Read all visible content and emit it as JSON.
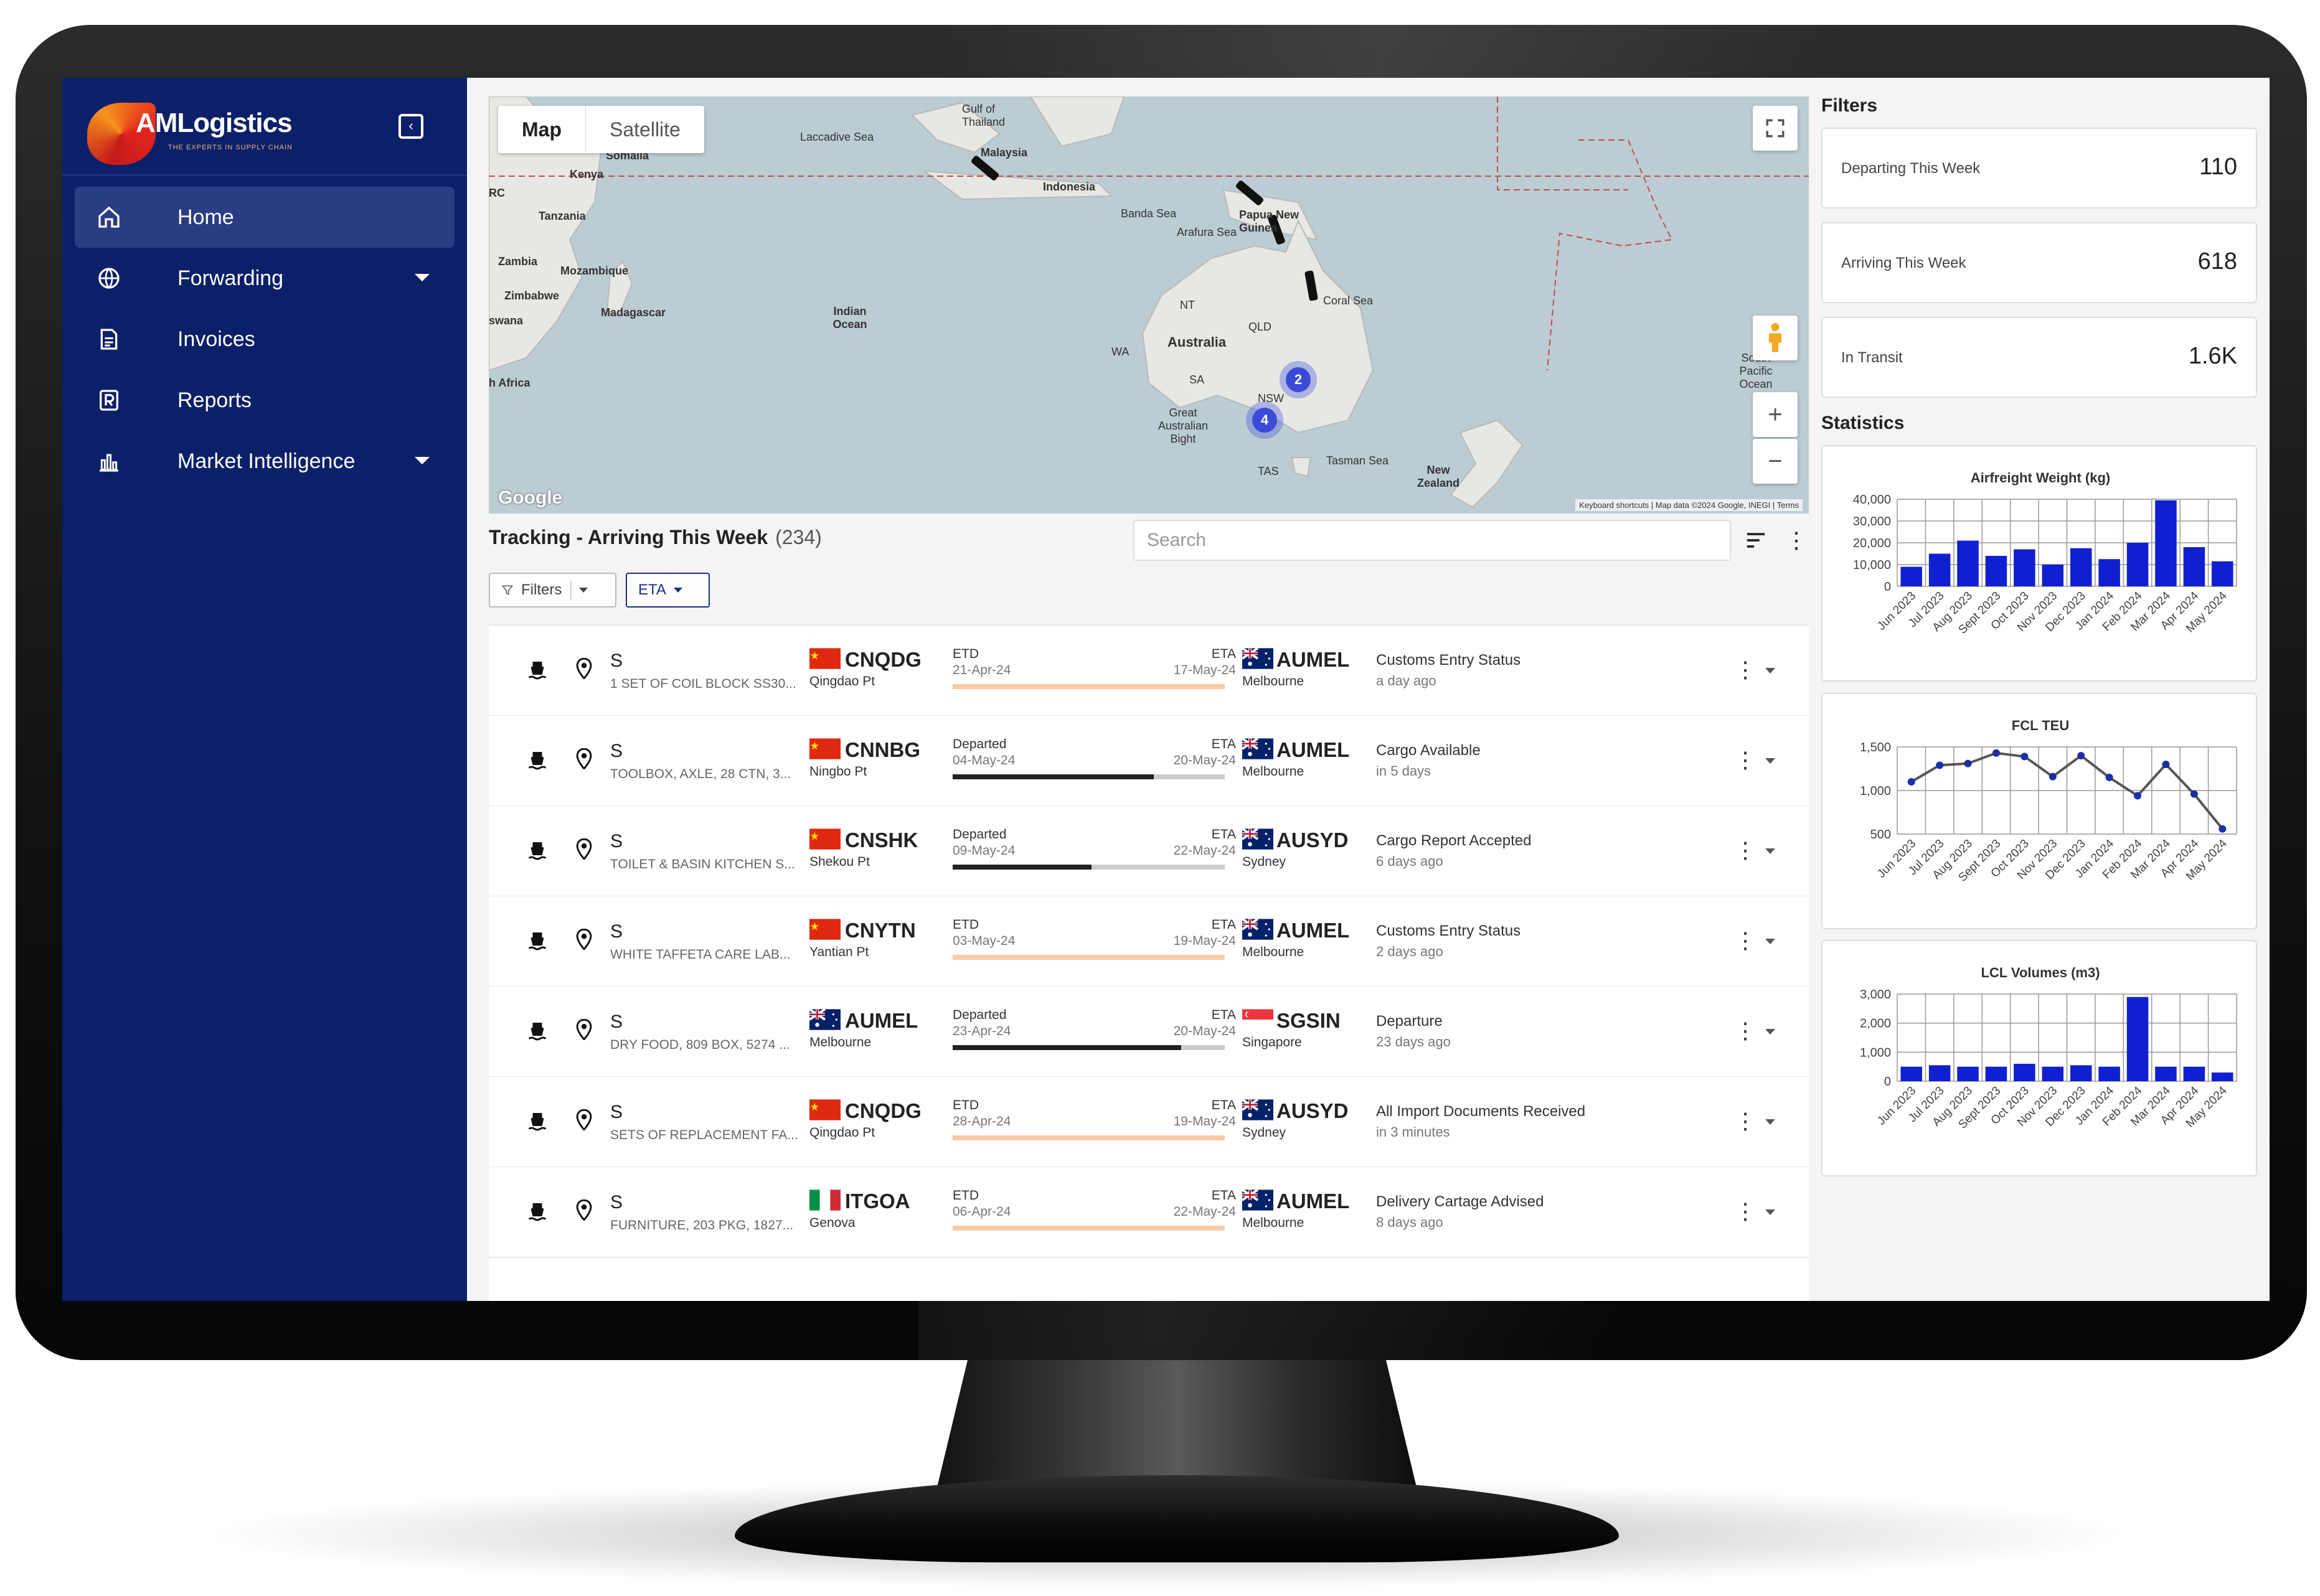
{
  "brand": {
    "name": "AMLogistics",
    "tagline": "THE EXPERTS IN SUPPLY CHAIN"
  },
  "sidebar": {
    "items": [
      {
        "label": "Home",
        "icon": "home-icon",
        "active": true
      },
      {
        "label": "Forwarding",
        "icon": "globe-icon",
        "has_submenu": true
      },
      {
        "label": "Invoices",
        "icon": "invoice-icon"
      },
      {
        "label": "Reports",
        "icon": "reports-icon"
      },
      {
        "label": "Market Intelligence",
        "icon": "bar-chart-icon",
        "has_submenu": true
      }
    ]
  },
  "map": {
    "toggle": {
      "map": "Map",
      "satellite": "Satellite"
    },
    "labels": [
      "Somalia",
      "Kenya",
      "Tanzania",
      "Zambia",
      "Mozambique",
      "Zimbabwe",
      "Madagascar",
      "Indian Ocean",
      "Malaysia",
      "Indonesia",
      "Banda Sea",
      "Arafura Sea",
      "Papua New Guinea",
      "Coral Sea",
      "NT",
      "QLD",
      "WA",
      "SA",
      "NSW",
      "Australia",
      "Great Australian Bight",
      "TAS",
      "Tasman Sea",
      "New Zealand",
      "South Pacific Ocean",
      "h Africa",
      "Laccadive Sea",
      "Gulf of Thailand",
      "RC",
      "swana"
    ],
    "clusters": [
      "2",
      "4"
    ],
    "footer": "Keyboard shortcuts | Map data ©2024 Google, INEGI | Terms",
    "google": "Google"
  },
  "tracking": {
    "title": "Tracking - Arriving This Week",
    "count": "(234)",
    "search_placeholder": "Search",
    "filters_label": "Filters",
    "eta_label": "ETA",
    "rows": [
      {
        "ref": "S",
        "desc": "1 SET OF COIL BLOCK SS30...",
        "origin_flag": "cn",
        "origin_code": "CNQDG",
        "origin_name": "Qingdao Pt",
        "origin_status": "ETD",
        "origin_date": "21-Apr-24",
        "eta_label": "ETA",
        "eta_date": "17-May-24",
        "progress": 0,
        "bar": "orange",
        "dest_flag": "au",
        "dest_code": "AUMEL",
        "dest_name": "Melbourne",
        "status": "Customs Entry Status",
        "when": "a day ago"
      },
      {
        "ref": "S",
        "desc": "TOOLBOX, AXLE, 28 CTN, 3...",
        "origin_flag": "cn",
        "origin_code": "CNNBG",
        "origin_name": "Ningbo Pt",
        "origin_status": "Departed",
        "origin_date": "04-May-24",
        "eta_label": "ETA",
        "eta_date": "20-May-24",
        "progress": 0.74,
        "bar": "grey",
        "dest_flag": "au",
        "dest_code": "AUMEL",
        "dest_name": "Melbourne",
        "status": "Cargo Available",
        "when": "in 5 days"
      },
      {
        "ref": "S",
        "desc": "TOILET & BASIN KITCHEN S...",
        "origin_flag": "cn",
        "origin_code": "CNSHK",
        "origin_name": "Shekou Pt",
        "origin_status": "Departed",
        "origin_date": "09-May-24",
        "eta_label": "ETA",
        "eta_date": "22-May-24",
        "progress": 0.51,
        "bar": "grey",
        "dest_flag": "au",
        "dest_code": "AUSYD",
        "dest_name": "Sydney",
        "status": "Cargo Report Accepted",
        "when": "6 days ago"
      },
      {
        "ref": "S",
        "desc": "WHITE TAFFETA CARE LAB...",
        "origin_flag": "cn",
        "origin_code": "CNYTN",
        "origin_name": "Yantian Pt",
        "origin_status": "ETD",
        "origin_date": "03-May-24",
        "eta_label": "ETA",
        "eta_date": "19-May-24",
        "progress": 0,
        "bar": "orange",
        "dest_flag": "au",
        "dest_code": "AUMEL",
        "dest_name": "Melbourne",
        "status": "Customs Entry Status",
        "when": "2 days ago"
      },
      {
        "ref": "S",
        "desc": "DRY FOOD, 809 BOX, 5274 ...",
        "origin_flag": "au",
        "origin_code": "AUMEL",
        "origin_name": "Melbourne",
        "origin_status": "Departed",
        "origin_date": "23-Apr-24",
        "eta_label": "ETA",
        "eta_date": "20-May-24",
        "progress": 0.84,
        "bar": "grey",
        "dest_flag": "sg",
        "dest_code": "SGSIN",
        "dest_name": "Singapore",
        "status": "Departure",
        "when": "23 days ago"
      },
      {
        "ref": "S",
        "desc": "SETS OF REPLACEMENT FA...",
        "origin_flag": "cn",
        "origin_code": "CNQDG",
        "origin_name": "Qingdao Pt",
        "origin_status": "ETD",
        "origin_date": "28-Apr-24",
        "eta_label": "ETA",
        "eta_date": "19-May-24",
        "progress": 0,
        "bar": "orange",
        "dest_flag": "au",
        "dest_code": "AUSYD",
        "dest_name": "Sydney",
        "status": "All Import Documents Received",
        "when": "in 3 minutes"
      },
      {
        "ref": "S",
        "desc": "FURNITURE, 203 PKG, 1827...",
        "origin_flag": "it",
        "origin_code": "ITGOA",
        "origin_name": "Genova",
        "origin_status": "ETD",
        "origin_date": "06-Apr-24",
        "eta_label": "ETA",
        "eta_date": "22-May-24",
        "progress": 0,
        "bar": "orange",
        "dest_flag": "au",
        "dest_code": "AUMEL",
        "dest_name": "Melbourne",
        "status": "Delivery Cartage Advised",
        "when": "8 days ago"
      }
    ]
  },
  "filters": {
    "heading": "Filters",
    "cards": [
      {
        "label": "Departing This Week",
        "value": "110"
      },
      {
        "label": "Arriving This Week",
        "value": "618"
      },
      {
        "label": "In Transit",
        "value": "1.6K"
      }
    ]
  },
  "statistics": {
    "heading": "Statistics"
  },
  "colors": {
    "sidebar": "#0c2069",
    "bar": "#1020d0",
    "line": "#555555",
    "accent": "#1c2f88"
  },
  "chart_data": [
    {
      "type": "bar",
      "title": "Airfreight Weight (kg)",
      "categories": [
        "Jun 2023",
        "Jul 2023",
        "Aug 2023",
        "Sept 2023",
        "Oct 2023",
        "Nov 2023",
        "Dec 2023",
        "Jan 2024",
        "Feb 2024",
        "Mar 2024",
        "Apr 2024",
        "May 2024"
      ],
      "values": [
        9000,
        15000,
        21000,
        14000,
        17000,
        10000,
        17500,
        12500,
        20000,
        39500,
        18000,
        11500
      ],
      "yticks": [
        "40,000",
        "30,000",
        "20,000",
        "10,000",
        "0"
      ],
      "ylim": [
        0,
        40000
      ]
    },
    {
      "type": "line",
      "title": "FCL TEU",
      "categories": [
        "Jun 2023",
        "Jul 2023",
        "Aug 2023",
        "Sept 2023",
        "Oct 2023",
        "Nov 2023",
        "Dec 2023",
        "Jan 2024",
        "Feb 2024",
        "Mar 2024",
        "Apr 2024",
        "May 2024"
      ],
      "values": [
        1100,
        1290,
        1310,
        1430,
        1390,
        1160,
        1400,
        1150,
        940,
        1300,
        960,
        560
      ],
      "yticks": [
        "1,500",
        "1,000",
        "500"
      ],
      "ylim": [
        500,
        1500
      ]
    },
    {
      "type": "bar",
      "title": "LCL Volumes (m3)",
      "categories": [
        "Jun 2023",
        "Jul 2023",
        "Aug 2023",
        "Sept 2023",
        "Oct 2023",
        "Nov 2023",
        "Dec 2023",
        "Jan 2024",
        "Feb 2024",
        "Mar 2024",
        "Apr 2024",
        "May 2024"
      ],
      "values": [
        500,
        550,
        500,
        500,
        600,
        500,
        550,
        500,
        2900,
        500,
        500,
        300
      ],
      "yticks": [
        "3,000",
        "2,000",
        "1,000",
        "0"
      ],
      "ylim": [
        0,
        3000
      ]
    }
  ]
}
